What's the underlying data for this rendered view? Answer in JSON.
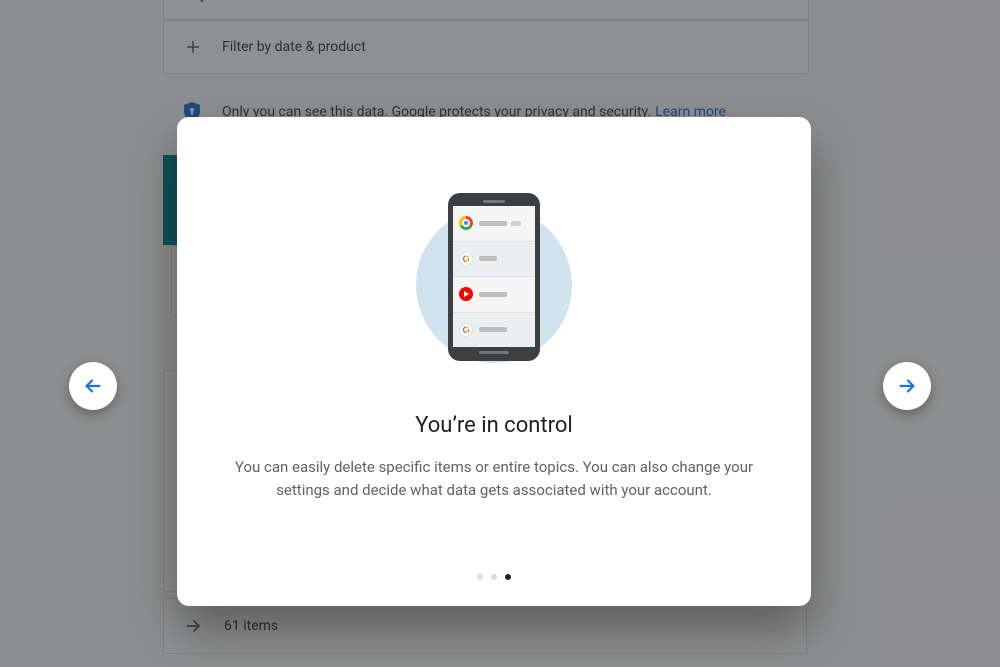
{
  "background": {
    "filter_label": "Filter by date & product",
    "privacy_text": "Only you can see this data. Google protects your privacy and security.",
    "learn_more": "Learn more",
    "footer_count": "61 items"
  },
  "modal": {
    "title": "You’re in control",
    "body": "You can easily delete specific items or entire topics. You can also change your settings and decide what data gets associated with your account.",
    "page_index": 2,
    "page_count": 3
  }
}
